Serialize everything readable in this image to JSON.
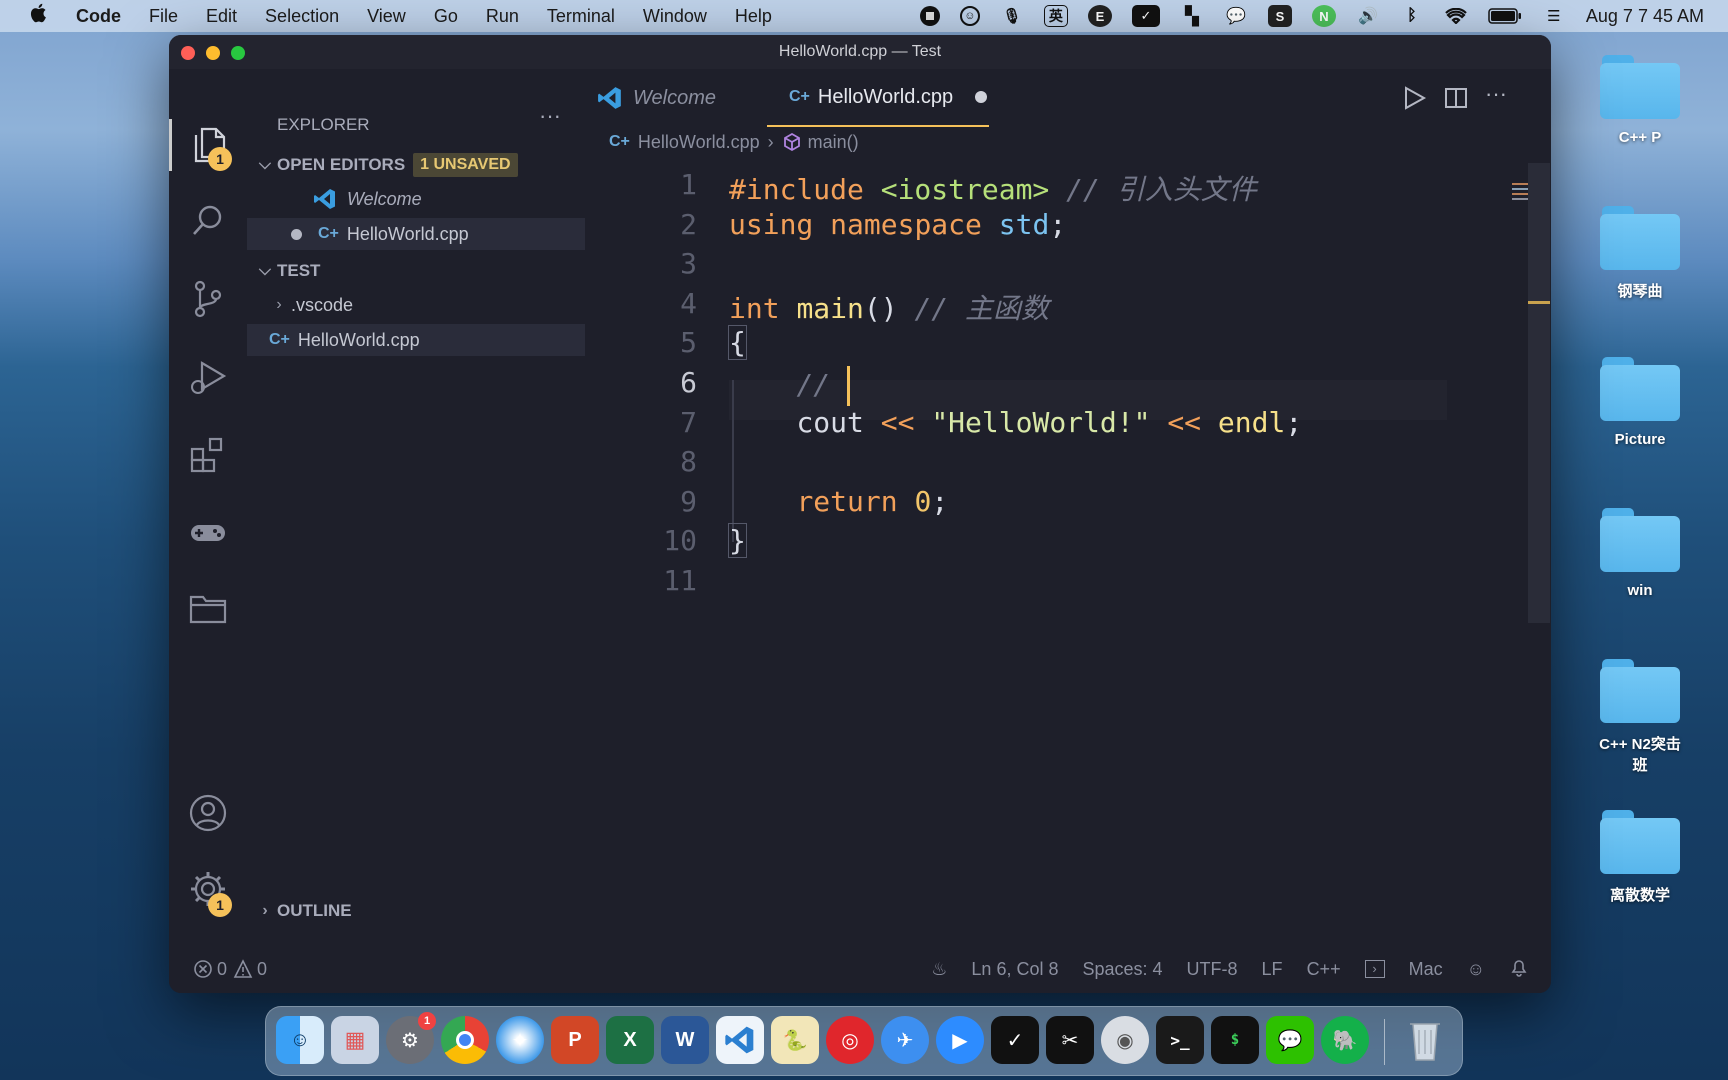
{
  "menubar": {
    "app_name": "Code",
    "items": [
      "File",
      "Edit",
      "Selection",
      "View",
      "Go",
      "Run",
      "Terminal",
      "Window",
      "Help"
    ],
    "input_method": "英",
    "clock": "Aug 7  7 45 AM"
  },
  "desktop": {
    "folders": [
      "C++ P",
      "钢琴曲",
      "Picture",
      "win",
      "C++ N2突击班",
      "离散数学"
    ]
  },
  "window": {
    "title": "HelloWorld.cpp — Test"
  },
  "activity_bar": {
    "explorer_badge": "1",
    "settings_badge": "1"
  },
  "sidebar": {
    "header": "EXPLORER",
    "more": "···",
    "open_editors_label": "OPEN EDITORS",
    "unsaved_badge": "1 UNSAVED",
    "open_editors": [
      "Welcome",
      "HelloWorld.cpp"
    ],
    "folder_label": "TEST",
    "tree": [
      ".vscode",
      "HelloWorld.cpp"
    ],
    "outline_label": "OUTLINE"
  },
  "tabs": [
    {
      "label": "Welcome"
    },
    {
      "label": "HelloWorld.cpp"
    }
  ],
  "breadcrumb": {
    "file": "HelloWorld.cpp",
    "symbol": "main()"
  },
  "code": {
    "line_numbers": [
      "1",
      "2",
      "3",
      "4",
      "5",
      "6",
      "7",
      "8",
      "9",
      "10",
      "11"
    ],
    "l1_include": "#include",
    "l1_header": "<iostream>",
    "l1_comment": "// 引入头文件",
    "l2_using": "using",
    "l2_namespace": "namespace",
    "l2_std": "std",
    "l2_semi": ";",
    "l4_int": "int",
    "l4_main": "main",
    "l4_parens": "()",
    "l4_comment": "// 主函数",
    "l5": "{",
    "l6_comment": "//",
    "l7_cout": "cout",
    "l7_op1": "<<",
    "l7_str": "\"HelloWorld!\"",
    "l7_op2": "<<",
    "l7_endl": "endl",
    "l7_semi": ";",
    "l9_return": "return",
    "l9_zero": "0",
    "l9_semi": ";",
    "l10": "}"
  },
  "status": {
    "errors": "0",
    "warnings": "0",
    "position": "Ln 6, Col 8",
    "spaces": "Spaces: 4",
    "encoding": "UTF-8",
    "eol": "LF",
    "language": "C++",
    "platform": "Mac"
  },
  "dock": {
    "settings_badge": "1"
  },
  "colors": {
    "editor_bg": "#1e1f2a",
    "accent": "#f5c15a",
    "keyword": "#f2a05a",
    "string": "#b6e07a"
  }
}
